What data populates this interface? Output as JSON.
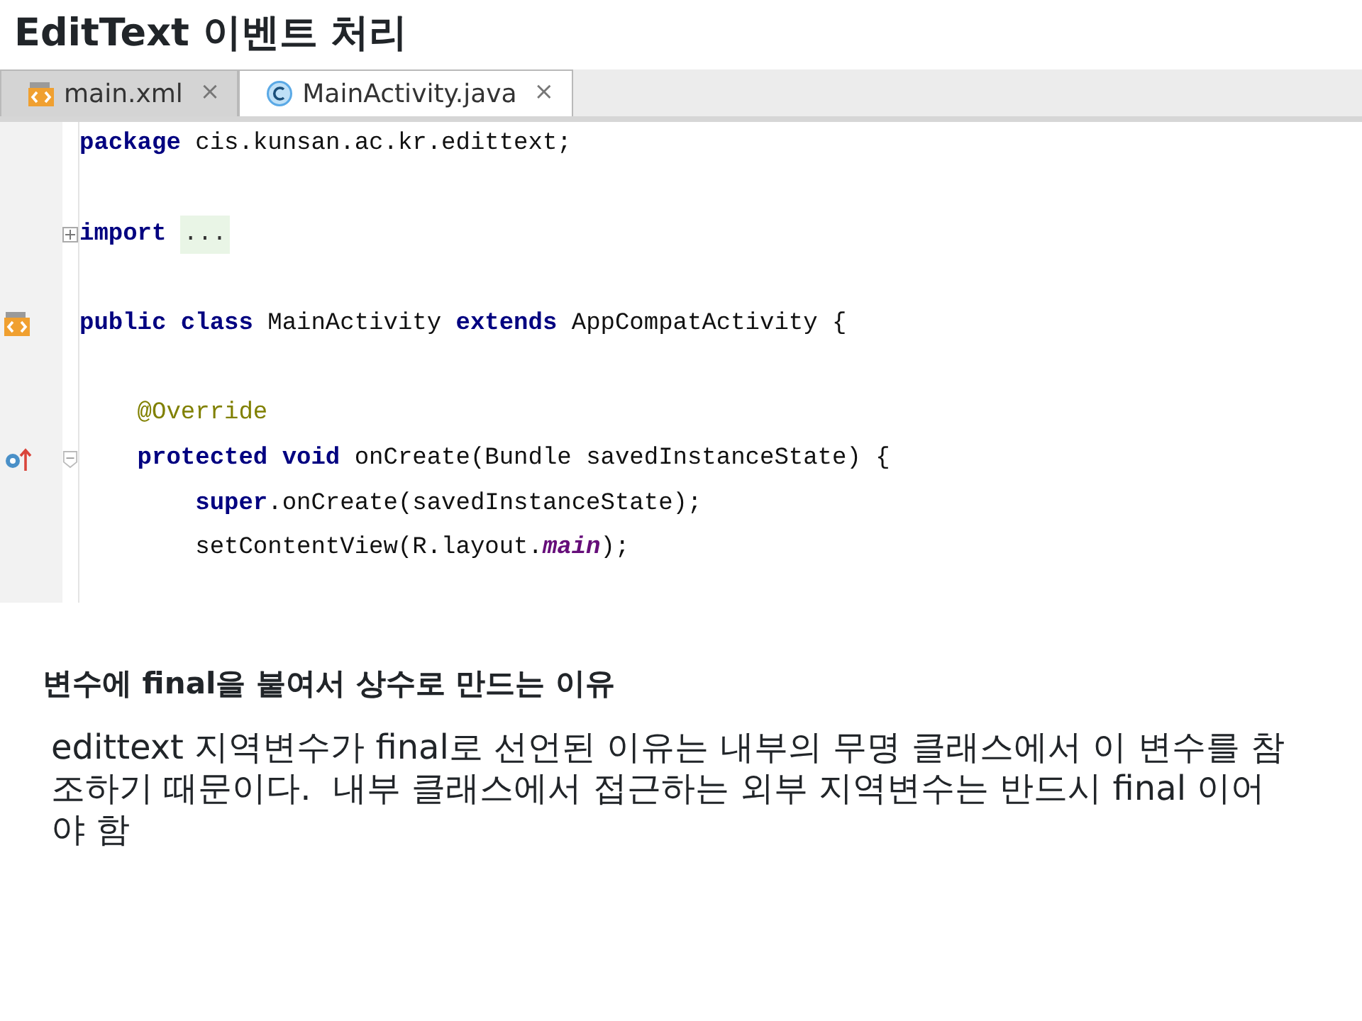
{
  "slide_title": "EditText 이벤트 처리",
  "editor": {
    "tabs": [
      {
        "kind": "xml",
        "label": "main.xml",
        "close": "×",
        "selected": false
      },
      {
        "kind": "class",
        "label": "MainActivity.java",
        "close": "×",
        "selected": true
      }
    ],
    "lines": [
      {
        "kind": "code",
        "tokens": [
          {
            "kind": "keyword",
            "text": "package"
          },
          {
            "kind": "plain",
            "text": " cis.kunsan.ac.kr.edittext;"
          }
        ]
      },
      {
        "kind": "blank"
      },
      {
        "kind": "code",
        "fold_mark": {
          "kind": "expand"
        },
        "tokens": [
          {
            "kind": "keyword",
            "text": "import"
          },
          {
            "kind": "folded",
            "text": "..."
          }
        ]
      },
      {
        "kind": "blank"
      },
      {
        "kind": "code",
        "gutter_mark": {
          "kind": "layout"
        },
        "tokens": [
          {
            "kind": "keyword",
            "text": "public class"
          },
          {
            "kind": "plain",
            "text": " MainActivity "
          },
          {
            "kind": "keyword",
            "text": "extends"
          },
          {
            "kind": "plain",
            "text": " AppCompatActivity {"
          }
        ]
      },
      {
        "kind": "blank"
      },
      {
        "kind": "code",
        "tokens": [
          {
            "kind": "annotation",
            "text": "    @Override"
          }
        ]
      },
      {
        "kind": "code",
        "gutter_mark": {
          "kind": "override"
        },
        "fold_mark": {
          "kind": "collapse"
        },
        "tokens": [
          {
            "kind": "keyword",
            "text": "    protected void"
          },
          {
            "kind": "plain",
            "text": " onCreate(Bundle savedInstanceState) {"
          }
        ]
      },
      {
        "kind": "code",
        "tokens": [
          {
            "kind": "keyword",
            "text": "        super"
          },
          {
            "kind": "plain",
            "text": ".onCreate(savedInstanceState);"
          }
        ]
      },
      {
        "kind": "code",
        "tokens": [
          {
            "kind": "plain",
            "text": "        setContentView(R.layout."
          },
          {
            "kind": "field",
            "text": "main"
          },
          {
            "kind": "plain",
            "text": ");"
          }
        ]
      }
    ]
  },
  "section_heading": "변수에 final을 붙여서 상수로 만드는 이유",
  "paragraph": "edittext 지역변수가 final로 선언된 이유는 내부의 무명 클래스에서 이 변수를 참조하기 때문이다.  내부 클래스에서 접근하는 외부 지역변수는 반드시 final 이어야 함"
}
